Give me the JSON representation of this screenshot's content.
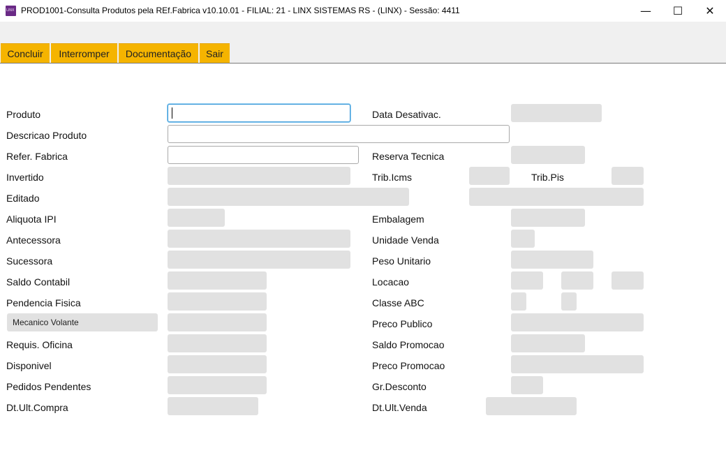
{
  "window": {
    "title": "PROD1001-Consulta Produtos pela REf.Fabrica v10.10.01   - FILIAL: 21 - LINX SISTEMAS RS - (LINX) - Sessão: 4411",
    "icon_text": "LINX",
    "icon": "linx-app-icon",
    "minimize": "—",
    "maximize": "☐",
    "close": "✕"
  },
  "toolbar": {
    "concluir": "Concluir",
    "interromper": "Interromper",
    "documentacao": "Documentação",
    "sair": "Sair",
    "accent": "#f5b400"
  },
  "form": {
    "produto": {
      "label": "Produto",
      "value": ""
    },
    "descricao_produto": {
      "label": "Descricao Produto",
      "value": ""
    },
    "refer_fabrica": {
      "label": "Refer. Fabrica",
      "value": ""
    },
    "invertido": {
      "label": "Invertido"
    },
    "editado": {
      "label": "Editado"
    },
    "aliquota_ipi": {
      "label": "Aliquota IPI"
    },
    "antecessora": {
      "label": "Antecessora"
    },
    "sucessora": {
      "label": "Sucessora"
    },
    "saldo_contabil": {
      "label": "Saldo Contabil"
    },
    "pendencia_fisica": {
      "label": "Pendencia Fisica"
    },
    "mecanico_volante": {
      "label": "Mecanico Volante"
    },
    "requis_oficina": {
      "label": "Requis. Oficina"
    },
    "disponivel": {
      "label": "Disponivel"
    },
    "pedidos_pendentes": {
      "label": "Pedidos Pendentes"
    },
    "dt_ult_compra": {
      "label": "Dt.Ult.Compra"
    },
    "data_desativac": {
      "label": "Data Desativac."
    },
    "reserva_tecnica": {
      "label": "Reserva Tecnica"
    },
    "trib_icms": {
      "label": "Trib.Icms"
    },
    "trib_pis": {
      "label": "Trib.Pis"
    },
    "embalagem": {
      "label": "Embalagem"
    },
    "unidade_venda": {
      "label": "Unidade Venda"
    },
    "peso_unitario": {
      "label": "Peso Unitario"
    },
    "locacao": {
      "label": "Locacao"
    },
    "classe_abc": {
      "label": "Classe ABC"
    },
    "preco_publico": {
      "label": "Preco Publico"
    },
    "saldo_promocao": {
      "label": "Saldo Promocao"
    },
    "preco_promocao": {
      "label": "Preco Promocao"
    },
    "gr_desconto": {
      "label": "Gr.Desconto"
    },
    "dt_ult_venda": {
      "label": "Dt.Ult.Venda"
    }
  }
}
